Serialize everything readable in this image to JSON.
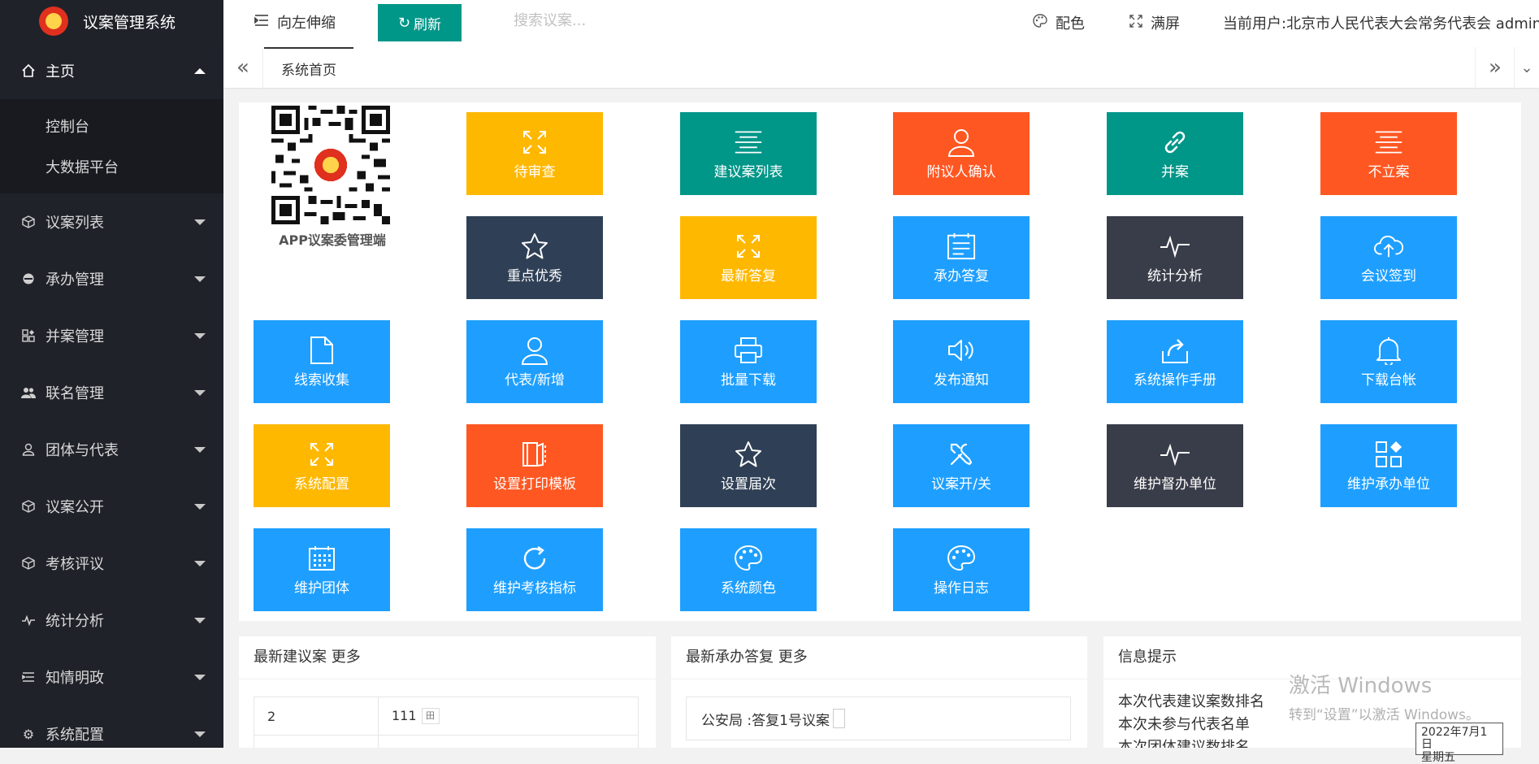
{
  "sidebar": {
    "app_title": "议案管理系统",
    "home": {
      "label": "主页",
      "icon": "home-icon"
    },
    "submenu": [
      {
        "label": "控制台"
      },
      {
        "label": "大数据平台"
      }
    ],
    "items": [
      {
        "label": "议案列表",
        "icon": "cube-icon"
      },
      {
        "label": "承办管理",
        "icon": "circle-icon"
      },
      {
        "label": "并案管理",
        "icon": "apps-icon"
      },
      {
        "label": "联名管理",
        "icon": "group-icon"
      },
      {
        "label": "团体与代表",
        "icon": "user-icon"
      },
      {
        "label": "议案公开",
        "icon": "cube-icon"
      },
      {
        "label": "考核评议",
        "icon": "cube-icon"
      },
      {
        "label": "统计分析",
        "icon": "chart-line-icon"
      },
      {
        "label": "知情明政",
        "icon": "list-icon"
      },
      {
        "label": "系统配置",
        "icon": "gear-icon"
      }
    ]
  },
  "header": {
    "toggle_label": "向左伸缩",
    "refresh_label": "刷新",
    "search_placeholder": "搜索议案...",
    "theme_label": "配色",
    "fullscreen_label": "满屏",
    "current_user": "当前用户:北京市人民代表大会常务代表会 admin"
  },
  "tabs": {
    "home_tab": "系统首页"
  },
  "qr": {
    "caption": "APP议案委管理端"
  },
  "tiles": [
    {
      "label": "待审查",
      "color": "#ffb800",
      "icon": "expand-icon"
    },
    {
      "label": "建议案列表",
      "color": "#009688",
      "icon": "align-center-icon"
    },
    {
      "label": "附议人确认",
      "color": "#ff5722",
      "icon": "user-icon"
    },
    {
      "label": "并案",
      "color": "#009688",
      "icon": "link-icon"
    },
    {
      "label": "不立案",
      "color": "#ff5722",
      "icon": "align-center-icon"
    },
    {
      "label": "重点优秀",
      "color": "#2f4056",
      "icon": "star-icon"
    },
    {
      "label": "最新答复",
      "color": "#ffb800",
      "icon": "expand-icon"
    },
    {
      "label": "承办答复",
      "color": "#1e9fff",
      "icon": "form-icon"
    },
    {
      "label": "统计分析",
      "color": "#393d49",
      "icon": "chart-line-icon"
    },
    {
      "label": "会议签到",
      "color": "#1e9fff",
      "icon": "upload-cloud-icon"
    },
    {
      "label": "线索收集",
      "color": "#1e9fff",
      "icon": "file-icon"
    },
    {
      "label": "代表/新增",
      "color": "#1e9fff",
      "icon": "user-icon"
    },
    {
      "label": "批量下载",
      "color": "#1e9fff",
      "icon": "print-icon"
    },
    {
      "label": "发布通知",
      "color": "#1e9fff",
      "icon": "speaker-icon"
    },
    {
      "label": "系统操作手册",
      "color": "#1e9fff",
      "icon": "share-icon"
    },
    {
      "label": "下载台帐",
      "color": "#1e9fff",
      "icon": "bell-icon"
    },
    {
      "label": "系统配置",
      "color": "#ffb800",
      "icon": "expand-icon"
    },
    {
      "label": "设置打印模板",
      "color": "#ff5722",
      "icon": "template-icon"
    },
    {
      "label": "设置届次",
      "color": "#2f4056",
      "icon": "star-icon"
    },
    {
      "label": "议案开/关",
      "color": "#1e9fff",
      "icon": "tools-icon"
    },
    {
      "label": "维护督办单位",
      "color": "#393d49",
      "icon": "chart-line-icon"
    },
    {
      "label": "维护承办单位",
      "color": "#1e9fff",
      "icon": "apps-icon"
    },
    {
      "label": "维护团体",
      "color": "#1e9fff",
      "icon": "calendar-icon"
    },
    {
      "label": "维护考核指标",
      "color": "#1e9fff",
      "icon": "refresh-icon"
    },
    {
      "label": "系统颜色",
      "color": "#1e9fff",
      "icon": "palette-icon"
    },
    {
      "label": "操作日志",
      "color": "#1e9fff",
      "icon": "palette-icon"
    }
  ],
  "cards": {
    "latest_proposals": {
      "title": "最新建议案 更多",
      "rows": [
        {
          "col1": "2",
          "col2": "111"
        }
      ]
    },
    "latest_replies": {
      "title": "最新承办答复 更多",
      "item": "公安局 :答复1号议案"
    },
    "info": {
      "title": "信息提示",
      "lines": [
        "本次代表建议案数排名",
        "本次未参与代表名单",
        "本次团体建议数排名"
      ]
    }
  },
  "os_overlay": {
    "activate_title": "激活 Windows",
    "activate_hint": "转到“设置”以激活 Windows。",
    "date": "2022年7月1日",
    "weekday": "星期五"
  }
}
